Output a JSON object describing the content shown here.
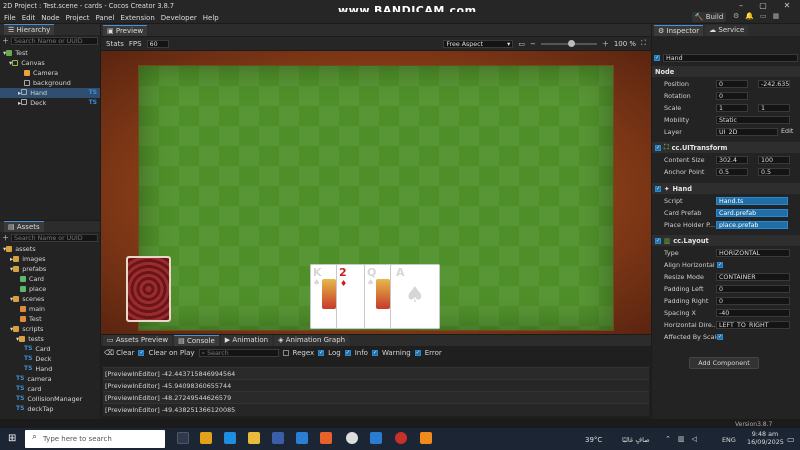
{
  "window": {
    "title": "2D Project : Test.scene - cards - Cocos Creator 3.8.7",
    "watermark": "www.BANDICAM.com"
  },
  "menu": [
    "File",
    "Edit",
    "Node",
    "Project",
    "Panel",
    "Extension",
    "Developer",
    "Help"
  ],
  "toolbar": {
    "build_label": "Build"
  },
  "hierarchy": {
    "tab": "Hierarchy",
    "search_placeholder": "Search Name or UUID",
    "items": [
      {
        "label": "Test",
        "badge": ""
      },
      {
        "label": "Canvas",
        "badge": ""
      },
      {
        "label": "Camera",
        "badge": ""
      },
      {
        "label": "background",
        "badge": ""
      },
      {
        "label": "Hand",
        "badge": "TS"
      },
      {
        "label": "Deck",
        "badge": "TS"
      }
    ]
  },
  "assets": {
    "tab": "Assets",
    "search_placeholder": "Search Name or UUID",
    "items": [
      {
        "label": "assets",
        "badge": ""
      },
      {
        "label": "images",
        "badge": ""
      },
      {
        "label": "prefabs",
        "badge": ""
      },
      {
        "label": "Card",
        "badge": ""
      },
      {
        "label": "place",
        "badge": ""
      },
      {
        "label": "scenes",
        "badge": ""
      },
      {
        "label": "main",
        "badge": ""
      },
      {
        "label": "Test",
        "badge": ""
      },
      {
        "label": "scripts",
        "badge": ""
      },
      {
        "label": "tests",
        "badge": ""
      },
      {
        "label": "Card",
        "badge": "TS"
      },
      {
        "label": "Deck",
        "badge": "TS"
      },
      {
        "label": "Hand",
        "badge": "TS"
      },
      {
        "label": "camera",
        "badge": "TS"
      },
      {
        "label": "card",
        "badge": "TS"
      },
      {
        "label": "CollisionManager",
        "badge": "TS"
      },
      {
        "label": "deckTap",
        "badge": "TS"
      }
    ]
  },
  "preview": {
    "tab": "Preview",
    "stats_label": "Stats",
    "fps_label": "FPS",
    "fps_value": "60",
    "aspect": "Free Aspect",
    "zoom": "100 %",
    "zoom_fraction": 0.55
  },
  "cards": [
    {
      "rank": "K",
      "suit": "♠",
      "color": "#111111"
    },
    {
      "rank": "2",
      "suit": "♦",
      "color": "#d11a1a"
    },
    {
      "rank": "Q",
      "suit": "♠",
      "color": "#111111"
    },
    {
      "rank": "A",
      "suit": "♠",
      "color": "#111111"
    }
  ],
  "console": {
    "tabs": [
      "Assets Preview",
      "Console",
      "Animation",
      "Animation Graph"
    ],
    "clear_label": "Clear",
    "clear_on_play_label": "Clear on Play",
    "search_placeholder": "Search",
    "filters": [
      "Regex",
      "Log",
      "Info",
      "Warning",
      "Error"
    ],
    "lines": [
      "[PreviewInEditor] -42.443715846994564",
      "[PreviewInEditor] -45.94098360655744",
      "[PreviewInEditor] -48.27249544626579",
      "[PreviewInEditor] -49.438251366120085"
    ]
  },
  "inspector": {
    "tabs": [
      "Inspector",
      "Service"
    ],
    "node_name": "Hand",
    "node": {
      "header": "Node",
      "position_label": "Position",
      "position_x": "0",
      "position_y": "-242.635",
      "rotation_label": "Rotation",
      "rotation": "0",
      "scale_label": "Scale",
      "scale_x": "1",
      "scale_y": "1",
      "mobility_label": "Mobility",
      "mobility": "Static",
      "layer_label": "Layer",
      "layer": "UI_2D",
      "edit_label": "Edit"
    },
    "uitransform": {
      "header": "cc.UITransform",
      "content_size_label": "Content Size",
      "width": "302.4",
      "height": "100",
      "anchor_label": "Anchor Point",
      "anchor_x": "0.5",
      "anchor_y": "0.5"
    },
    "hand": {
      "header": "Hand",
      "script_label": "Script",
      "script": "Hand.ts",
      "card_prefab_label": "Card Prefab",
      "card_prefab": "Card.prefab",
      "place_holder_label": "Place Holder P...",
      "place_holder": "place.prefab"
    },
    "layout": {
      "header": "cc.Layout",
      "type_label": "Type",
      "type": "HORIZONTAL",
      "align_label": "Align Horizontal",
      "resize_label": "Resize Mode",
      "resize": "CONTAINER",
      "padding_left_label": "Padding Left",
      "padding_left": "0",
      "padding_right_label": "Padding Right",
      "padding_right": "0",
      "spacing_label": "Spacing X",
      "spacing": "-40",
      "direction_label": "Horizontal Dire...",
      "direction": "LEFT_TO_RIGHT",
      "affected_label": "Affected By Scale"
    },
    "add_component_label": "Add Component",
    "version": "Version3.8.7"
  },
  "taskbar": {
    "search_placeholder": "Type here to search",
    "weather": "39°C",
    "weather_text": "صافٍ غالبًا",
    "lang": "ENG",
    "time": "9:48 am",
    "date": "16/09/2025"
  },
  "colors": {
    "accent": "#4a90d9",
    "field_blue": "#1f6ea8",
    "grass": "#4f8f2a"
  }
}
